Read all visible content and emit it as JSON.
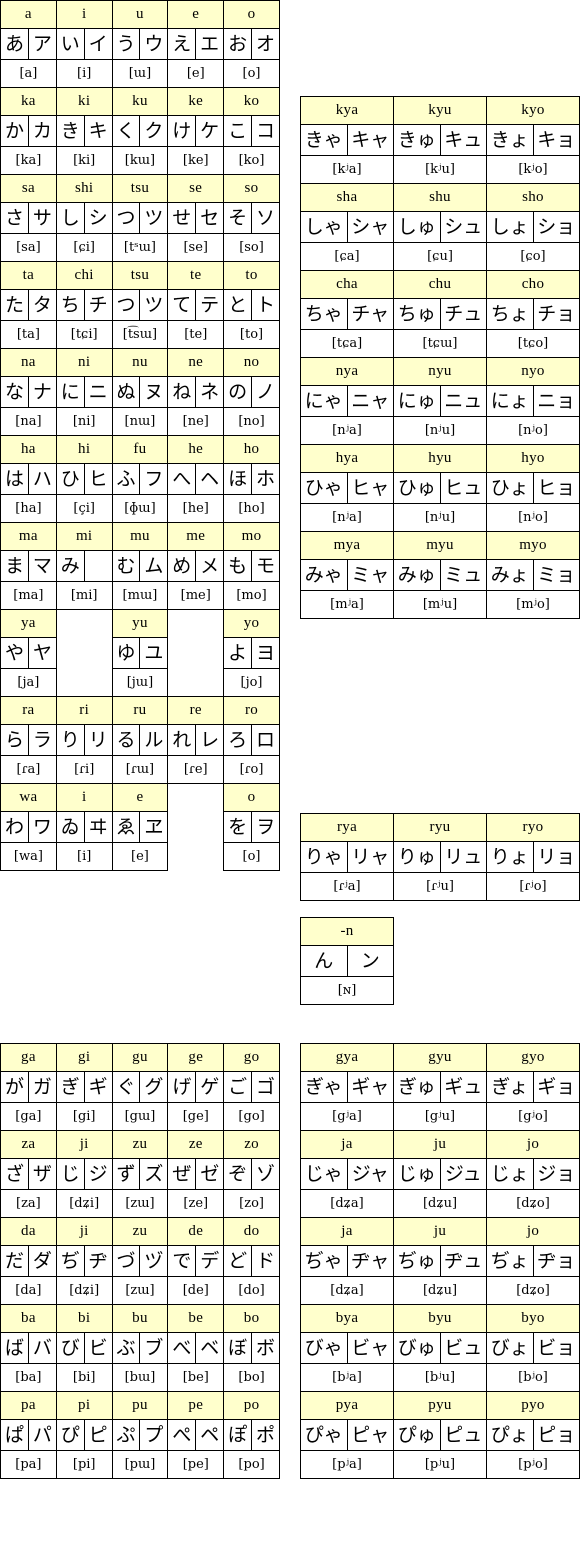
{
  "meta": {
    "title": "Japanese kana chart (hiragana / katakana with IPA)",
    "header_bg": "#ffffcc",
    "cell_bg": "#ffffff",
    "border_color": "#000000"
  },
  "groups": [
    {
      "id": "group-basic-plain",
      "name": "basic-syllables-plain",
      "columns": 5,
      "rows": [
        {
          "romaji": [
            "a",
            "i",
            "u",
            "e",
            "o"
          ],
          "kana": [
            [
              "あ",
              "ア"
            ],
            [
              "い",
              "イ"
            ],
            [
              "う",
              "ウ"
            ],
            [
              "え",
              "エ"
            ],
            [
              "お",
              "オ"
            ]
          ],
          "ipa": [
            "[a]",
            "[i]",
            "[ɯ]",
            "[e]",
            "[o]"
          ]
        },
        {
          "romaji": [
            "ka",
            "ki",
            "ku",
            "ke",
            "ko"
          ],
          "kana": [
            [
              "か",
              "カ"
            ],
            [
              "き",
              "キ"
            ],
            [
              "く",
              "ク"
            ],
            [
              "け",
              "ケ"
            ],
            [
              "こ",
              "コ"
            ]
          ],
          "ipa": [
            "[ka]",
            "[ki]",
            "[kɯ]",
            "[ke]",
            "[ko]"
          ]
        },
        {
          "romaji": [
            "sa",
            "shi",
            "tsu",
            "se",
            "so"
          ],
          "kana": [
            [
              "さ",
              "サ"
            ],
            [
              "し",
              "シ"
            ],
            [
              "つ",
              "ツ"
            ],
            [
              "せ",
              "セ"
            ],
            [
              "そ",
              "ソ"
            ]
          ],
          "ipa": [
            "[sa]",
            "[ɕi]",
            "[tˢɯ]",
            "[se]",
            "[so]"
          ]
        },
        {
          "romaji": [
            "ta",
            "chi",
            "tsu",
            "te",
            "to"
          ],
          "kana": [
            [
              "た",
              "タ"
            ],
            [
              "ち",
              "チ"
            ],
            [
              "つ",
              "ツ"
            ],
            [
              "て",
              "テ"
            ],
            [
              "と",
              "ト"
            ]
          ],
          "ipa": [
            "[ta]",
            "[tɕi]",
            "[t͡sɯ]",
            "[te]",
            "[to]"
          ]
        },
        {
          "romaji": [
            "na",
            "ni",
            "nu",
            "ne",
            "no"
          ],
          "kana": [
            [
              "な",
              "ナ"
            ],
            [
              "に",
              "ニ"
            ],
            [
              "ぬ",
              "ヌ"
            ],
            [
              "ね",
              "ネ"
            ],
            [
              "の",
              "ノ"
            ]
          ],
          "ipa": [
            "[na]",
            "[ni]",
            "[nɯ]",
            "[ne]",
            "[no]"
          ]
        },
        {
          "romaji": [
            "ha",
            "hi",
            "fu",
            "he",
            "ho"
          ],
          "kana": [
            [
              "は",
              "ハ"
            ],
            [
              "ひ",
              "ヒ"
            ],
            [
              "ふ",
              "フ"
            ],
            [
              "へ",
              "ヘ"
            ],
            [
              "ほ",
              "ホ"
            ]
          ],
          "ipa": [
            "[ha]",
            "[çi]",
            "[ɸɯ]",
            "[he]",
            "[ho]"
          ]
        },
        {
          "romaji": [
            "ma",
            "mi",
            "mu",
            "me",
            "mo"
          ],
          "kana": [
            [
              "ま",
              "マ"
            ],
            [
              "み",
              ""
            ],
            [
              "む",
              "ム"
            ],
            [
              "め",
              "メ"
            ],
            [
              "も",
              "モ"
            ]
          ],
          "ipa": [
            "[ma]",
            "[mi]",
            "[mɯ]",
            "[me]",
            "[mo]"
          ]
        },
        {
          "romaji": [
            "ya",
            "",
            "yu",
            "",
            "yo"
          ],
          "kana": [
            [
              "や",
              "ヤ"
            ],
            null,
            [
              "ゆ",
              "ユ"
            ],
            null,
            [
              "よ",
              "ヨ"
            ]
          ],
          "ipa": [
            "[ja]",
            "",
            "[jɯ]",
            "",
            "[jo]"
          ],
          "empty": [
            false,
            true,
            false,
            true,
            false
          ]
        },
        {
          "romaji": [
            "ra",
            "ri",
            "ru",
            "re",
            "ro"
          ],
          "kana": [
            [
              "ら",
              "ラ"
            ],
            [
              "り",
              "リ"
            ],
            [
              "る",
              "ル"
            ],
            [
              "れ",
              "レ"
            ],
            [
              "ろ",
              "ロ"
            ]
          ],
          "ipa": [
            "[ɾa]",
            "[ɾi]",
            "[ɾɯ]",
            "[ɾe]",
            "[ɾo]"
          ]
        },
        {
          "romaji": [
            "wa",
            "i",
            "e",
            "",
            "o"
          ],
          "kana": [
            [
              "わ",
              "ワ"
            ],
            [
              "ゐ",
              "ヰ"
            ],
            [
              "ゑ",
              "ヱ"
            ],
            null,
            [
              "を",
              "ヲ"
            ]
          ],
          "ipa": [
            "[wa]",
            "[i]",
            "[e]",
            "",
            "[o]"
          ],
          "empty": [
            false,
            false,
            false,
            true,
            false
          ]
        }
      ]
    },
    {
      "id": "group-basic-yoon",
      "name": "basic-syllables-yoon",
      "columns": 3,
      "rows": [
        {
          "romaji": [
            "kya",
            "kyu",
            "kyo"
          ],
          "kana": [
            [
              "きゃ",
              "キャ"
            ],
            [
              "きゅ",
              "キュ"
            ],
            [
              "きょ",
              "キョ"
            ]
          ],
          "ipa": [
            "[kʲa]",
            "[kʲu]",
            "[kʲo]"
          ]
        },
        {
          "romaji": [
            "sha",
            "shu",
            "sho"
          ],
          "kana": [
            [
              "しゃ",
              "シャ"
            ],
            [
              "しゅ",
              "シュ"
            ],
            [
              "しょ",
              "ショ"
            ]
          ],
          "ipa": [
            "[ɕa]",
            "[ɕu]",
            "[ɕo]"
          ]
        },
        {
          "romaji": [
            "cha",
            "chu",
            "cho"
          ],
          "kana": [
            [
              "ちゃ",
              "チャ"
            ],
            [
              "ちゅ",
              "チュ"
            ],
            [
              "ちょ",
              "チョ"
            ]
          ],
          "ipa": [
            "[tɕa]",
            "[tɕɯ]",
            "[tɕo]"
          ]
        },
        {
          "romaji": [
            "nya",
            "nyu",
            "nyo"
          ],
          "kana": [
            [
              "にゃ",
              "ニャ"
            ],
            [
              "にゅ",
              "ニュ"
            ],
            [
              "にょ",
              "ニョ"
            ]
          ],
          "ipa": [
            "[nʲa]",
            "[nʲu]",
            "[nʲo]"
          ]
        },
        {
          "romaji": [
            "hya",
            "hyu",
            "hyo"
          ],
          "kana": [
            [
              "ひゃ",
              "ヒャ"
            ],
            [
              "ひゅ",
              "ヒュ"
            ],
            [
              "ひょ",
              "ヒョ"
            ]
          ],
          "ipa": [
            "[nʲa]",
            "[nʲu]",
            "[nʲo]"
          ]
        },
        {
          "romaji": [
            "mya",
            "myu",
            "myo"
          ],
          "kana": [
            [
              "みゃ",
              "ミャ"
            ],
            [
              "みゅ",
              "ミュ"
            ],
            [
              "みょ",
              "ミョ"
            ]
          ],
          "ipa": [
            "[mʲa]",
            "[mʲu]",
            "[mʲo]"
          ]
        }
      ]
    },
    {
      "id": "group-basic-yoon-r",
      "name": "basic-syllables-yoon-r",
      "columns": 3,
      "rows": [
        {
          "romaji": [
            "rya",
            "ryu",
            "ryo"
          ],
          "kana": [
            [
              "りゃ",
              "リャ"
            ],
            [
              "りゅ",
              "リュ"
            ],
            [
              "りょ",
              "リョ"
            ]
          ],
          "ipa": [
            "[ɾʲa]",
            "[ɾʲu]",
            "[ɾʲo]"
          ]
        }
      ]
    },
    {
      "id": "group-moraic-n",
      "name": "moraic-nasal",
      "columns": 1,
      "rows": [
        {
          "romaji": [
            "-n"
          ],
          "kana": [
            [
              "ん",
              "ン"
            ]
          ],
          "ipa": [
            "[ɴ]"
          ]
        }
      ]
    },
    {
      "id": "group-voiced-plain",
      "name": "voiced-syllables-plain",
      "columns": 5,
      "rows": [
        {
          "romaji": [
            "ga",
            "gi",
            "gu",
            "ge",
            "go"
          ],
          "kana": [
            [
              "が",
              "ガ"
            ],
            [
              "ぎ",
              "ギ"
            ],
            [
              "ぐ",
              "グ"
            ],
            [
              "げ",
              "ゲ"
            ],
            [
              "ご",
              "ゴ"
            ]
          ],
          "ipa": [
            "[ga]",
            "[gi]",
            "[gɯ]",
            "[ge]",
            "[go]"
          ]
        },
        {
          "romaji": [
            "za",
            "ji",
            "zu",
            "ze",
            "zo"
          ],
          "kana": [
            [
              "ざ",
              "ザ"
            ],
            [
              "じ",
              "ジ"
            ],
            [
              "ず",
              "ズ"
            ],
            [
              "ぜ",
              "ゼ"
            ],
            [
              "ぞ",
              "ゾ"
            ]
          ],
          "ipa": [
            "[za]",
            "[dʑi]",
            "[zɯ]",
            "[ze]",
            "[zo]"
          ]
        },
        {
          "romaji": [
            "da",
            "ji",
            "zu",
            "de",
            "do"
          ],
          "kana": [
            [
              "だ",
              "ダ"
            ],
            [
              "ぢ",
              "ヂ"
            ],
            [
              "づ",
              "ヅ"
            ],
            [
              "で",
              "デ"
            ],
            [
              "ど",
              "ド"
            ]
          ],
          "ipa": [
            "[da]",
            "[dʑi]",
            "[zɯ]",
            "[de]",
            "[do]"
          ]
        },
        {
          "romaji": [
            "ba",
            "bi",
            "bu",
            "be",
            "bo"
          ],
          "kana": [
            [
              "ば",
              "バ"
            ],
            [
              "び",
              "ビ"
            ],
            [
              "ぶ",
              "ブ"
            ],
            [
              "べ",
              "ベ"
            ],
            [
              "ぼ",
              "ボ"
            ]
          ],
          "ipa": [
            "[ba]",
            "[bi]",
            "[bɯ]",
            "[be]",
            "[bo]"
          ]
        },
        {
          "romaji": [
            "pa",
            "pi",
            "pu",
            "pe",
            "po"
          ],
          "kana": [
            [
              "ぱ",
              "パ"
            ],
            [
              "ぴ",
              "ピ"
            ],
            [
              "ぷ",
              "プ"
            ],
            [
              "ぺ",
              "ペ"
            ],
            [
              "ぽ",
              "ポ"
            ]
          ],
          "ipa": [
            "[pa]",
            "[pi]",
            "[pɯ]",
            "[pe]",
            "[po]"
          ]
        }
      ]
    },
    {
      "id": "group-voiced-yoon",
      "name": "voiced-syllables-yoon",
      "columns": 3,
      "rows": [
        {
          "romaji": [
            "gya",
            "gyu",
            "gyo"
          ],
          "kana": [
            [
              "ぎゃ",
              "ギャ"
            ],
            [
              "ぎゅ",
              "ギュ"
            ],
            [
              "ぎょ",
              "ギョ"
            ]
          ],
          "ipa": [
            "[gʲa]",
            "[gʲu]",
            "[gʲo]"
          ]
        },
        {
          "romaji": [
            "ja",
            "ju",
            "jo"
          ],
          "kana": [
            [
              "じゃ",
              "ジャ"
            ],
            [
              "じゅ",
              "ジュ"
            ],
            [
              "じょ",
              "ジョ"
            ]
          ],
          "ipa": [
            "[dʑa]",
            "[dʑu]",
            "[dʑo]"
          ]
        },
        {
          "romaji": [
            "ja",
            "ju",
            "jo"
          ],
          "kana": [
            [
              "ぢゃ",
              "ヂャ"
            ],
            [
              "ぢゅ",
              "ヂュ"
            ],
            [
              "ぢょ",
              "ヂョ"
            ]
          ],
          "ipa": [
            "[dʑa]",
            "[dʑu]",
            "[dʑo]"
          ]
        },
        {
          "romaji": [
            "bya",
            "byu",
            "byo"
          ],
          "kana": [
            [
              "びゃ",
              "ビャ"
            ],
            [
              "びゅ",
              "ビュ"
            ],
            [
              "びょ",
              "ビョ"
            ]
          ],
          "ipa": [
            "[bʲa]",
            "[bʲu]",
            "[bʲo]"
          ]
        },
        {
          "romaji": [
            "pya",
            "pyu",
            "pyo"
          ],
          "kana": [
            [
              "ぴゃ",
              "ピャ"
            ],
            [
              "ぴゅ",
              "ピュ"
            ],
            [
              "ぴょ",
              "ピョ"
            ]
          ],
          "ipa": [
            "[pʲa]",
            "[pʲu]",
            "[pʲo]"
          ]
        }
      ]
    }
  ]
}
